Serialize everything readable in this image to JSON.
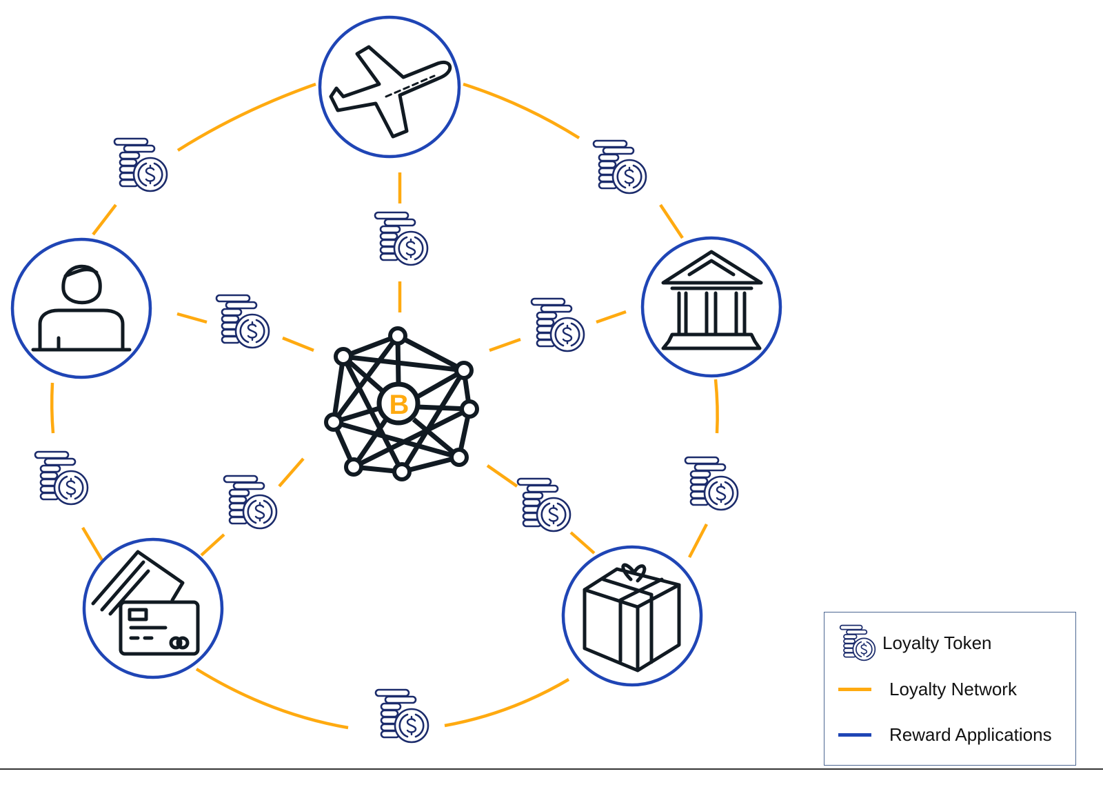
{
  "colors": {
    "network": "#ffaa10",
    "application": "#1f45b5",
    "token": "#1b2b6b",
    "icon": "#111a22"
  },
  "applications": [
    {
      "name": "airline",
      "icon": "airplane-icon"
    },
    {
      "name": "consumer",
      "icon": "person-icon"
    },
    {
      "name": "bank",
      "icon": "bank-icon"
    },
    {
      "name": "credit-card",
      "icon": "credit-card-icon"
    },
    {
      "name": "gift",
      "icon": "gift-icon"
    }
  ],
  "hub": {
    "icon": "blockchain-network-icon",
    "symbol": "B"
  },
  "legend": {
    "items": [
      {
        "label": "Loyalty Token",
        "icon": "coin-stack-icon"
      },
      {
        "label": "Loyalty Network",
        "icon": "orange-line"
      },
      {
        "label": "Reward Applications",
        "icon": "blue-line"
      }
    ]
  }
}
